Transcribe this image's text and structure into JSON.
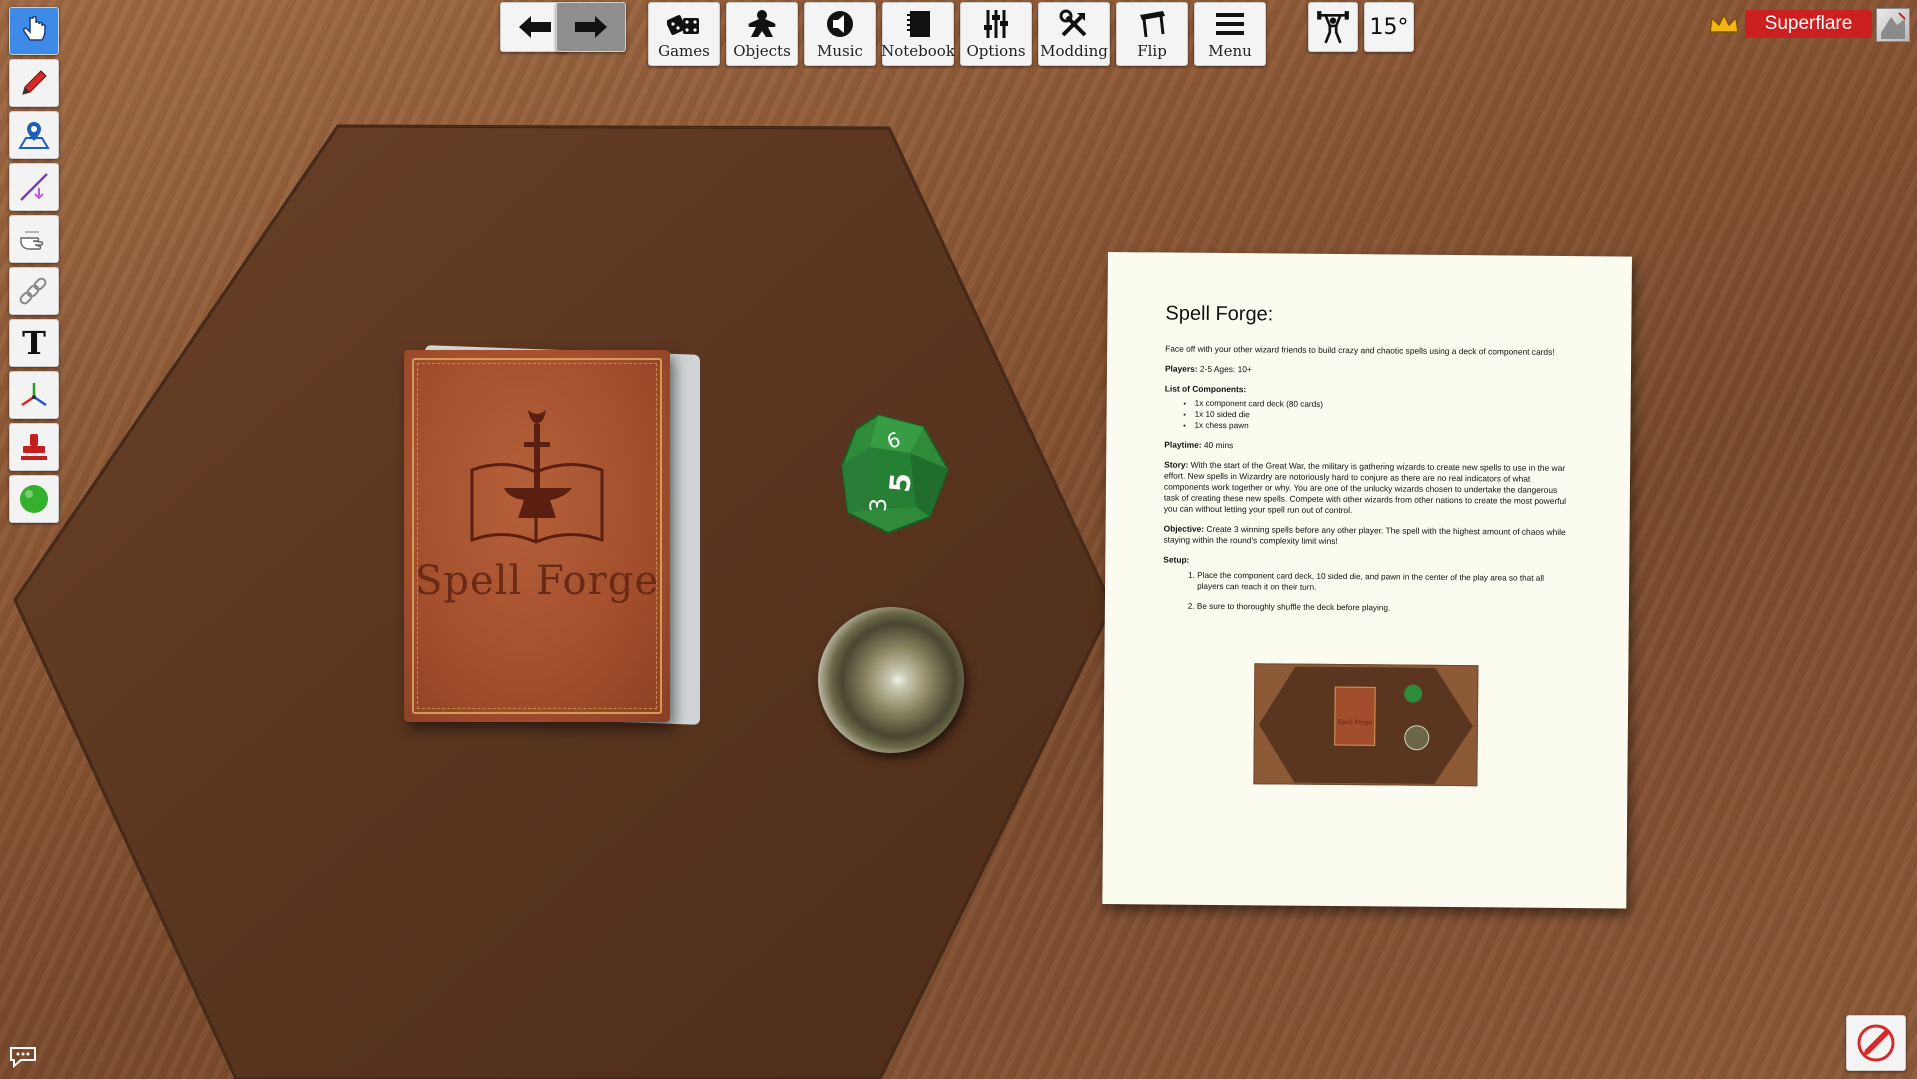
{
  "left_toolbar": {
    "tools": [
      {
        "name": "grab-tool",
        "icon": "hand-pointer-icon",
        "active": true
      },
      {
        "name": "draw-tool",
        "icon": "pencil-icon",
        "active": false
      },
      {
        "name": "map-pin-tool",
        "icon": "map-pin-icon",
        "active": false
      },
      {
        "name": "line-tool",
        "icon": "ruler-line-icon",
        "active": false
      },
      {
        "name": "flick-tool",
        "icon": "flick-hand-icon",
        "active": false
      },
      {
        "name": "joint-tool",
        "icon": "chain-link-icon",
        "active": false
      },
      {
        "name": "text-tool",
        "icon": "text-t-icon",
        "active": false
      },
      {
        "name": "gizmo-tool",
        "icon": "axis-gizmo-icon",
        "active": false
      },
      {
        "name": "snap-tool",
        "icon": "stamp-icon",
        "active": false
      },
      {
        "name": "color-tool",
        "icon": "green-circle-icon",
        "active": false
      }
    ],
    "text_glyph": "T"
  },
  "top_toolbar": {
    "buttons": [
      {
        "label": "Games",
        "icon": "dice-icon"
      },
      {
        "label": "Objects",
        "icon": "meeple-icon"
      },
      {
        "label": "Music",
        "icon": "speaker-icon"
      },
      {
        "label": "Notebook",
        "icon": "notebook-icon"
      },
      {
        "label": "Options",
        "icon": "sliders-icon"
      },
      {
        "label": "Modding",
        "icon": "tools-icon"
      },
      {
        "label": "Flip",
        "icon": "flip-table-icon"
      },
      {
        "label": "Menu",
        "icon": "hamburger-icon"
      }
    ],
    "rotation_label": "15°"
  },
  "player": {
    "name": "Superflare",
    "color": "#cc1f1f"
  },
  "deck": {
    "title": "Spell Forge"
  },
  "die": {
    "faces": [
      "6",
      "5",
      "3"
    ],
    "color": "#2f8a3a"
  },
  "document": {
    "title": "Spell Forge:",
    "intro": "Face off with your other wizard friends to build crazy and chaotic spells using a deck of component cards!",
    "players_label": "Players:",
    "players_value": "2-5 Ages: 10+",
    "components_label": "List of Components:",
    "components": [
      "1x component card deck (80 cards)",
      "1x 10 sided die",
      "1x chess pawn"
    ],
    "playtime_label": "Playtime:",
    "playtime_value": "40 mins",
    "story_label": "Story:",
    "story_value": "With the start of the Great War, the military is gathering wizards to create new spells to use in the war effort. New spells in Wizardry are notoriously hard to conjure as there are no real indicators of what components work together or why. You are one of the unlucky wizards chosen to undertake the dangerous task of creating these new spells. Compete with other wizards from other nations to create the most powerful you can without letting your spell run out of control.",
    "objective_label": "Objective:",
    "objective_value": "Create 3 winning spells before any other player. The spell with the highest amount of chaos while staying within the round's complexity limit wins!",
    "setup_label": "Setup:",
    "setup_steps": [
      "Place the component card deck, 10 sided die, and pawn in the center of the play area so that all players can reach it on their turn.",
      "Be sure to thoroughly shuffle the deck before playing."
    ],
    "mini_deck_title": "Spell Forge"
  },
  "colors": {
    "active_tool": "#3d8be6",
    "table_hex": "#5a3520",
    "wood": "#8a5634"
  }
}
